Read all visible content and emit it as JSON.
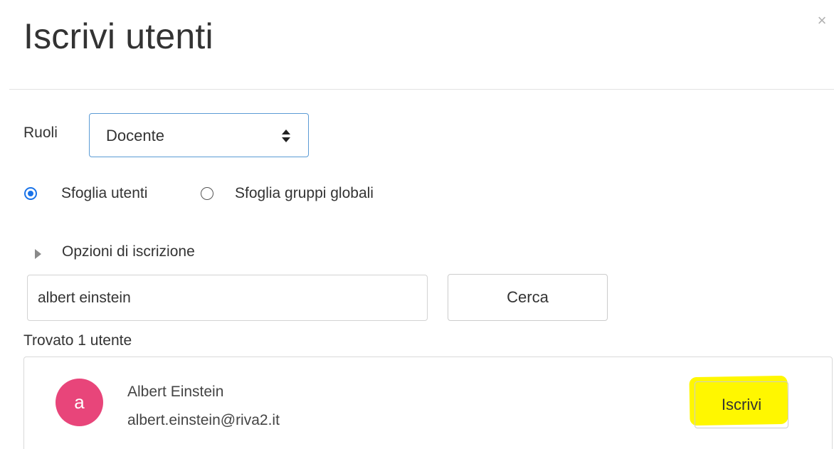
{
  "dialog": {
    "title": "Iscrivi utenti",
    "close_glyph": "×"
  },
  "roles": {
    "label": "Ruoli",
    "selected": "Docente",
    "icon": "sort-arrows-icon"
  },
  "browse": {
    "options": [
      {
        "label": "Sfoglia utenti",
        "checked": true
      },
      {
        "label": "Sfoglia gruppi globali",
        "checked": false
      }
    ]
  },
  "enrol_options": {
    "label": "Opzioni di iscrizione",
    "icon": "caret-right-icon"
  },
  "search": {
    "value": "albert einstein",
    "button_label": "Cerca"
  },
  "results": {
    "summary": "Trovato 1 utente",
    "users": [
      {
        "avatar_letter": "a",
        "avatar_color": "#e8457a",
        "name": "Albert Einstein",
        "email": "albert.einstein@riva2.it",
        "action_label": "Iscrivi"
      }
    ]
  },
  "colors": {
    "accent": "#1a73e8",
    "select_border": "#5b9bd5",
    "highlight": "#fff700"
  }
}
